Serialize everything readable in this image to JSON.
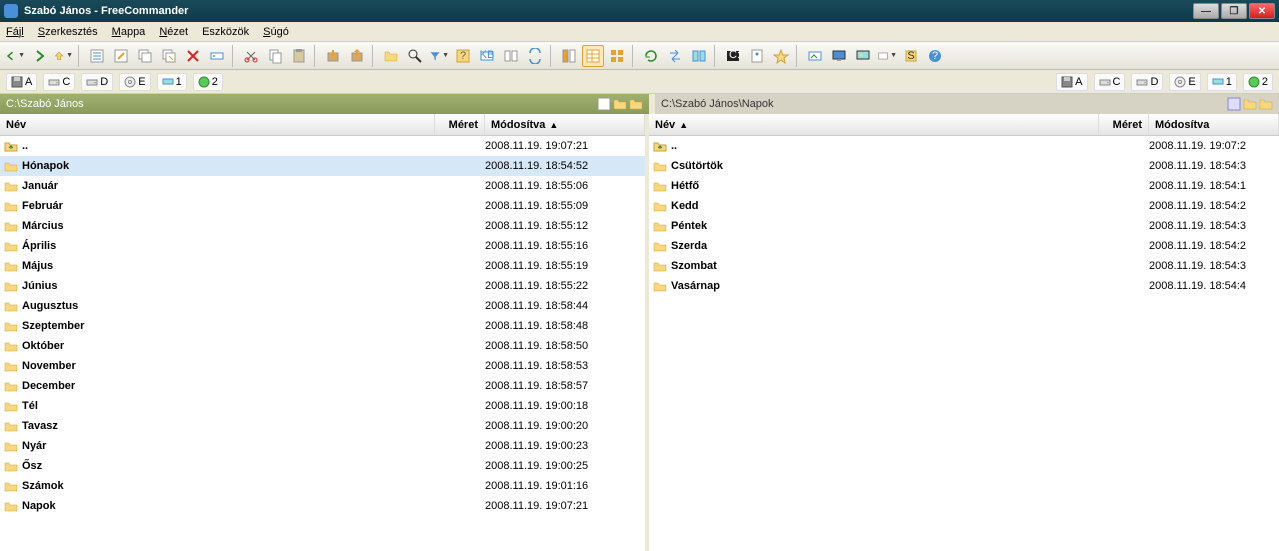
{
  "title": "Szabó János - FreeCommander",
  "menu": [
    "Fájl",
    "Szerkesztés",
    "Mappa",
    "Nézet",
    "Eszközök",
    "Súgó"
  ],
  "drives": [
    {
      "label": "A",
      "kind": "floppy"
    },
    {
      "label": "C",
      "kind": "hdd"
    },
    {
      "label": "D",
      "kind": "hdd"
    },
    {
      "label": "E",
      "kind": "cd"
    },
    {
      "label": "1",
      "kind": "net"
    },
    {
      "label": "2",
      "kind": "ftp"
    }
  ],
  "leftPath": "C:\\Szabó János",
  "rightPath": "C:\\Szabó János\\Napok",
  "cols": {
    "name": "Név",
    "size": "Méret",
    "mod": "Módosítva"
  },
  "leftSort": "mod-asc",
  "rightSort": "name-asc",
  "leftSelectedIndex": 1,
  "leftRows": [
    {
      "name": "..",
      "mod": "2008.11.19. 19:07:21",
      "up": true
    },
    {
      "name": "Hónapok",
      "mod": "2008.11.19. 18:54:52"
    },
    {
      "name": "Január",
      "mod": "2008.11.19. 18:55:06"
    },
    {
      "name": "Február",
      "mod": "2008.11.19. 18:55:09"
    },
    {
      "name": "Március",
      "mod": "2008.11.19. 18:55:12"
    },
    {
      "name": "Április",
      "mod": "2008.11.19. 18:55:16"
    },
    {
      "name": "Május",
      "mod": "2008.11.19. 18:55:19"
    },
    {
      "name": "Június",
      "mod": "2008.11.19. 18:55:22"
    },
    {
      "name": "Augusztus",
      "mod": "2008.11.19. 18:58:44"
    },
    {
      "name": "Szeptember",
      "mod": "2008.11.19. 18:58:48"
    },
    {
      "name": "Október",
      "mod": "2008.11.19. 18:58:50"
    },
    {
      "name": "November",
      "mod": "2008.11.19. 18:58:53"
    },
    {
      "name": "December",
      "mod": "2008.11.19. 18:58:57"
    },
    {
      "name": "Tél",
      "mod": "2008.11.19. 19:00:18"
    },
    {
      "name": "Tavasz",
      "mod": "2008.11.19. 19:00:20"
    },
    {
      "name": "Nyár",
      "mod": "2008.11.19. 19:00:23"
    },
    {
      "name": "Ősz",
      "mod": "2008.11.19. 19:00:25"
    },
    {
      "name": "Számok",
      "mod": "2008.11.19. 19:01:16"
    },
    {
      "name": "Napok",
      "mod": "2008.11.19. 19:07:21"
    }
  ],
  "rightRows": [
    {
      "name": "..",
      "mod": "2008.11.19. 19:07:2",
      "up": true
    },
    {
      "name": "Csütörtök",
      "mod": "2008.11.19. 18:54:3"
    },
    {
      "name": "Hétfő",
      "mod": "2008.11.19. 18:54:1"
    },
    {
      "name": "Kedd",
      "mod": "2008.11.19. 18:54:2"
    },
    {
      "name": "Péntek",
      "mod": "2008.11.19. 18:54:3"
    },
    {
      "name": "Szerda",
      "mod": "2008.11.19. 18:54:2"
    },
    {
      "name": "Szombat",
      "mod": "2008.11.19. 18:54:3"
    },
    {
      "name": "Vasárnap",
      "mod": "2008.11.19. 18:54:4"
    }
  ]
}
